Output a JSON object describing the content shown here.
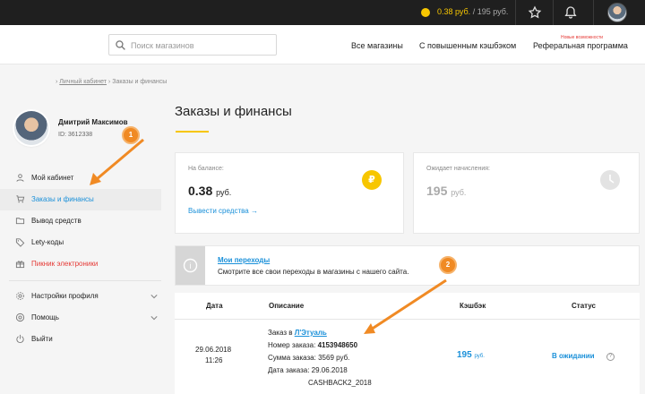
{
  "topbar": {
    "balance": "0.38 руб.",
    "separator": "/",
    "pending": "195 руб.",
    "icons": [
      "star-icon",
      "bell-icon",
      "user-avatar"
    ]
  },
  "header": {
    "search_placeholder": "Поиск магазинов",
    "nav": [
      "Все магазины",
      "С повышенным кэшбэком",
      "Реферальная программа"
    ],
    "nav_badge": "Новые возможности"
  },
  "breadcrumb": {
    "sep": "›",
    "home": "Личный кабинет",
    "current": "Заказы и финансы"
  },
  "profile": {
    "name": "Дмитрий Максимов",
    "id": "ID: 3612338"
  },
  "sidebar": {
    "items": [
      {
        "label": "Мой кабинет",
        "icon": "user-icon"
      },
      {
        "label": "Заказы и финансы",
        "icon": "cart-icon"
      },
      {
        "label": "Вывод средств",
        "icon": "folder-icon"
      },
      {
        "label": "Lety-коды",
        "icon": "tag-icon"
      },
      {
        "label": "Пикник электроники",
        "icon": "gift-icon"
      },
      {
        "label": "Настройки профиля",
        "icon": "gear-icon"
      },
      {
        "label": "Помощь",
        "icon": "help-icon"
      },
      {
        "label": "Выйти",
        "icon": "logout-icon"
      }
    ]
  },
  "main": {
    "title": "Заказы и финансы",
    "balance_card": {
      "label": "На балансе:",
      "value": "0.38",
      "unit": "руб.",
      "link": "Вывести средства →",
      "coin": "₽"
    },
    "pending_card": {
      "label": "Ожидает начисления:",
      "value": "195",
      "unit": "руб."
    },
    "info": {
      "link": "Мои переходы",
      "text": "Смотрите все свои переходы в магазины с нашего сайта.",
      "icon_glyph": "i"
    },
    "table": {
      "headers": [
        "Дата",
        "Описание",
        "Кэшбэк",
        "Статус"
      ],
      "row": {
        "date": "29.06.2018",
        "time": "11:26",
        "order_prefix": "Заказ в",
        "shop": "Л'Этуаль",
        "number_label": "Номер заказа:",
        "number": "4153948650",
        "sum_label": "Сумма заказа:",
        "sum": "3569 руб.",
        "date_label": "Дата заказа:",
        "order_date": "29.06.2018",
        "code": "CASHBACK2_2018",
        "cashback": "195",
        "cashback_unit": "руб.",
        "status": "В ожидании",
        "help": "?"
      }
    }
  },
  "annotations": {
    "badge_1": "1",
    "badge_2": "2",
    "accent": "#f08a24"
  },
  "colors": {
    "brand_yellow": "#f7c600",
    "link_blue": "#1a90d9",
    "promo_red": "#e53935",
    "topbar": "#1f1f1f"
  }
}
